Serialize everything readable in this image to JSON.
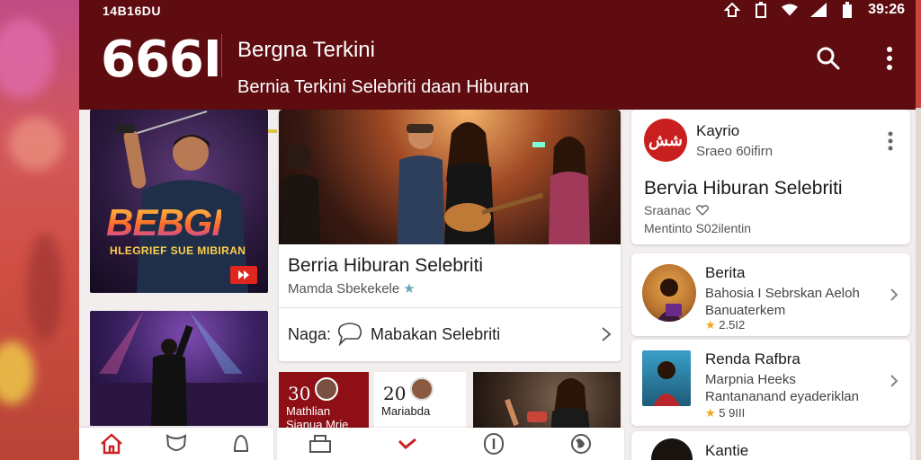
{
  "status": {
    "left_text": "14B16DU",
    "time": "39:26"
  },
  "app_bar": {
    "logo": "666I",
    "title": "Bergna Terkini",
    "subtitle": "Bernia Terkini Selebriti  daan  Hiburan"
  },
  "left_column": {
    "poster_title": "BEBGI",
    "poster_subtitle": "HLEGRIEF SUE MIBIRAN"
  },
  "main_card": {
    "title": "Berria Hiburan Selebriti",
    "meta": "Mamda Sbekekele",
    "row_label": "Naga:",
    "row_value": "Mabakan Selebriti"
  },
  "tiles": [
    {
      "number": "30",
      "label_line1": "Mathlian",
      "label_line2": "Sianua Mrie"
    },
    {
      "number": "20",
      "label_line1": "Mariabda",
      "label_line2": ""
    }
  ],
  "profile_card": {
    "avatar_text": "شش",
    "name": "Kayrio",
    "handle": "Sraeo 60ifirn",
    "title": "Bervia Hiburan Selebriti",
    "meta1": "Sraanac",
    "meta2": "Mentinto S02ilentin"
  },
  "list": [
    {
      "title": "Berita",
      "line1": "Bahosia I Sebrskan Aeloh",
      "line2": "Banuaterkem",
      "rating": "2.5I2"
    },
    {
      "title": "Renda Rafbra",
      "line1": "Marpnia Heeks",
      "line2": "Rantananand  eyaderiklan",
      "rating": "5 9III"
    },
    {
      "title": "Kantie"
    }
  ],
  "colors": {
    "header": "#5e0c10",
    "accent_red": "#c9201f",
    "star": "#f2a51a"
  },
  "icons": [
    "wifi-icon",
    "signal-icon",
    "battery-icon",
    "search-icon",
    "more-vert-icon",
    "home-icon",
    "shield-icon",
    "bookmark-icon",
    "library-icon",
    "chevron-right-icon"
  ]
}
